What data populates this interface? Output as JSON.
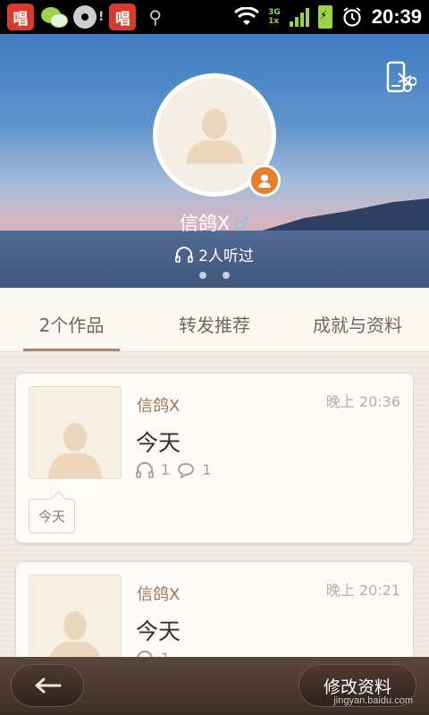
{
  "status_bar": {
    "app_icon_label": "唱",
    "notice_mark": "!",
    "network_top": "3G",
    "network_bottom": "1x",
    "time": "20:39",
    "colors": {
      "app_icon": "#d83a2e",
      "signal": "#9ad24a"
    }
  },
  "profile": {
    "name": "信鸽X",
    "gender_symbol": "♂",
    "listen_count_text": "2人听过",
    "page_dots": 2
  },
  "tabs": [
    {
      "label": "2个作品",
      "active": true
    },
    {
      "label": "转发推荐",
      "active": false
    },
    {
      "label": "成就与资料",
      "active": false
    }
  ],
  "works": [
    {
      "author": "信鸽X",
      "time": "晚上 20:36",
      "title": "今天",
      "listens": "1",
      "comments": "1",
      "tag": "今天"
    },
    {
      "author": "信鸽X",
      "time": "晚上 20:21",
      "title": "今天",
      "listens": "1"
    }
  ],
  "bottom_bar": {
    "edit_label": "修改资料",
    "watermark": "jingyan.baidu.com"
  },
  "icons": {
    "share": "phone-scissors-icon",
    "headphone": "headphone-icon",
    "comment": "comment-bubble-icon",
    "back": "left-arrow-icon",
    "badge": "person-badge-icon"
  },
  "colors": {
    "accent": "#e87d2c",
    "tab_text": "#7a6456",
    "author": "#a0755b",
    "bottom_bar": "#3d2e26"
  }
}
